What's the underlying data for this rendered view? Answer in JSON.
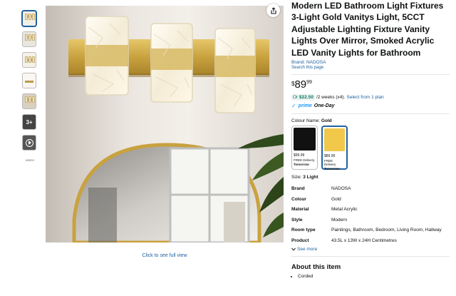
{
  "thumbnails": {
    "more_label": "3+",
    "video_label": "VIDEO"
  },
  "gallery": {
    "caption": "Click to see full view"
  },
  "product": {
    "title": "Modern LED Bathroom Light Fixtures 3-Light Gold Vanitys Light, 5CCT Adjustable Lighting Fixture Vanity Lights Over Mirror, Smoked Acrylic LED Vanity Lights for Bathroom",
    "brand_link": "Brand: NADOSA",
    "search_link": "Search this page",
    "price_symbol": "$",
    "price_whole": "89",
    "price_fraction": "99",
    "installment": {
      "or": "Or",
      "amount": "$22.50",
      "terms": "/2 weeks (x4).",
      "link": "Select from 1 plan"
    },
    "prime": {
      "check": "✓",
      "word": "prime",
      "day": "One-Day"
    },
    "colour_name_label": "Colour Name:",
    "colour_name_value": "Gold",
    "swatches": [
      {
        "price": "$99.99",
        "delivery": "FREE Delivery",
        "when": "Tomorrow",
        "color": "#111111"
      },
      {
        "price": "$89.99",
        "delivery": "FREE Delivery",
        "when": "Tomorrow",
        "color": "#f2c84b"
      }
    ],
    "size_label": "Size:",
    "size_value": "3 Light",
    "specs": [
      {
        "key": "Brand",
        "value": "NADOSA"
      },
      {
        "key": "Colour",
        "value": "Gold"
      },
      {
        "key": "Material",
        "value": "Metal Acrylic"
      },
      {
        "key": "Style",
        "value": "Modern"
      },
      {
        "key": "Room type",
        "value": "Paintings, Bathroom, Bedroom, Living Room, Hallway"
      },
      {
        "key": "Product",
        "value": "43.5L x 13W x 24H Centimetres"
      }
    ],
    "see_more": "See more",
    "about_heading": "About this item",
    "bullets": [
      "Corded"
    ]
  },
  "colors": {
    "link": "#2162a1",
    "green": "#067d62",
    "prime_blue": "#1a98ff"
  }
}
